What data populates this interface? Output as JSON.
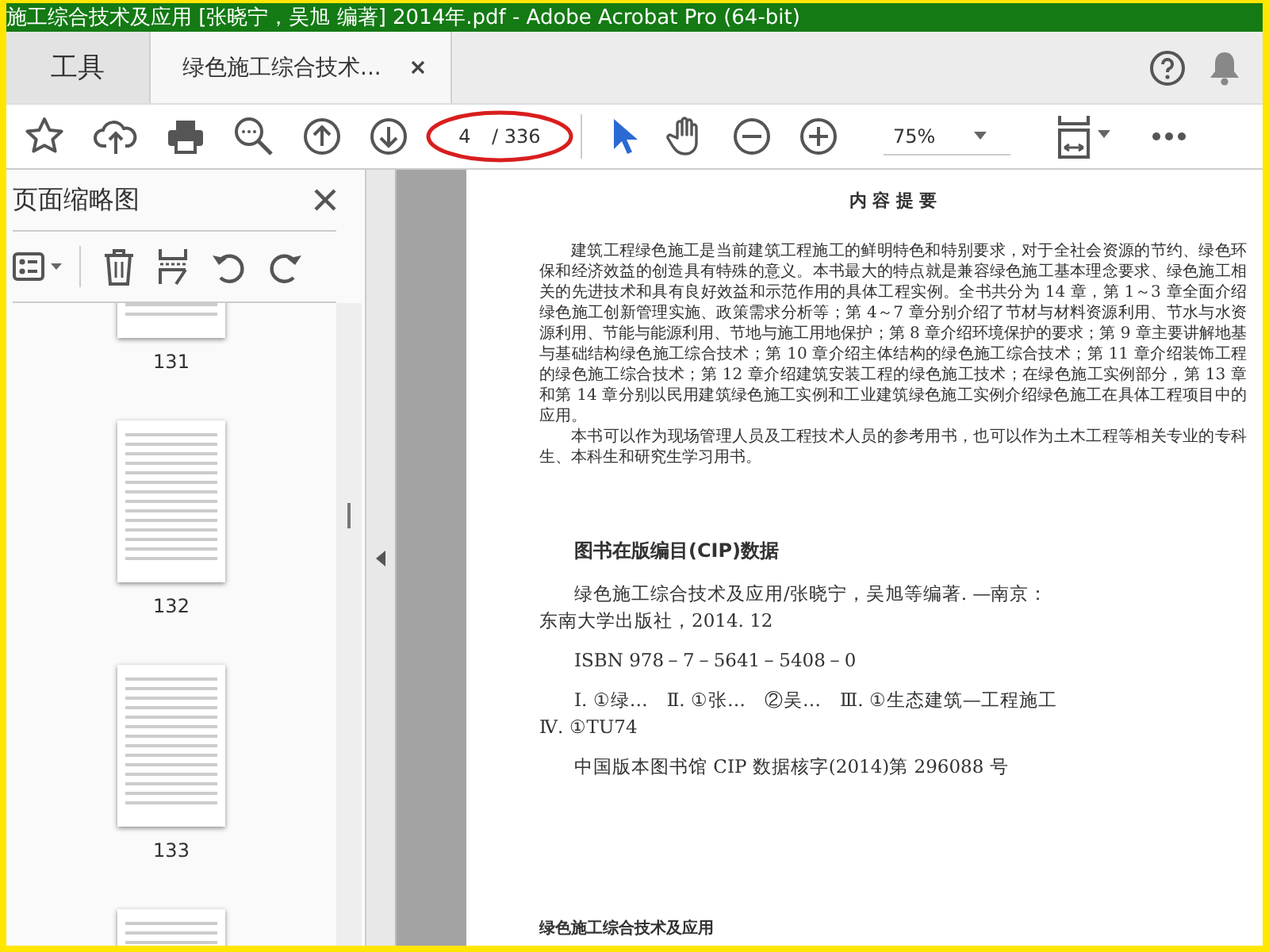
{
  "window": {
    "title": "施工综合技术及应用 [张晓宁，吴旭 编著] 2014年.pdf - Adobe Acrobat Pro (64-bit)"
  },
  "tabs": [
    {
      "label": "工具",
      "selected": false,
      "closable": false
    },
    {
      "label": "绿色施工综合技术...",
      "selected": true,
      "closable": true
    }
  ],
  "toolbar": {
    "page_number": "4",
    "page_count": "/ 336",
    "zoom": "75%"
  },
  "sidebar": {
    "title": "页面缩略图",
    "thumbnail_labels": [
      "131",
      "132",
      "133"
    ]
  },
  "document": {
    "heading": "内 容 提 要",
    "paragraphs": [
      "建筑工程绿色施工是当前建筑工程施工的鲜明特色和特别要求，对于全社会资源的节约、绿色环保和经济效益的创造具有特殊的意义。本书最大的特点就是兼容绿色施工基本理念要求、绿色施工相关的先进技术和具有良好效益和示范作用的具体工程实例。全书共分为 14 章，第 1～3 章全面介绍绿色施工创新管理实施、政策需求分析等；第 4～7 章分别介绍了节材与材料资源利用、节水与水资源利用、节能与能源利用、节地与施工用地保护；第 8 章介绍环境保护的要求；第 9 章主要讲解地基与基础结构绿色施工综合技术；第 10 章介绍主体结构的绿色施工综合技术；第 11 章介绍装饰工程的绿色施工综合技术；第 12 章介绍建筑安装工程的绿色施工技术；在绿色施工实例部分，第 13 章和第 14 章分别以民用建筑绿色施工实例和工业建筑绿色施工实例介绍绿色施工在具体工程项目中的应用。",
      "本书可以作为现场管理人员及工程技术人员的参考用书，也可以作为土木工程等相关专业的专科生、本科生和研究生学习用书。"
    ],
    "cip_heading": "图书在版编目(CIP)数据",
    "cip_entries": [
      "绿色施工综合技术及应用/张晓宁，吴旭等编著. —南京：东南大学出版社，2014. 12",
      "ISBN 978－7－5641－5408－0",
      "Ⅰ. ①绿…　Ⅱ. ①张…　②吴…　Ⅲ. ①生态建筑—工程施工　Ⅳ. ①TU74",
      "中国版本图书馆 CIP 数据核字(2014)第 296088 号"
    ],
    "footer": "绿色施工综合技术及应用"
  }
}
